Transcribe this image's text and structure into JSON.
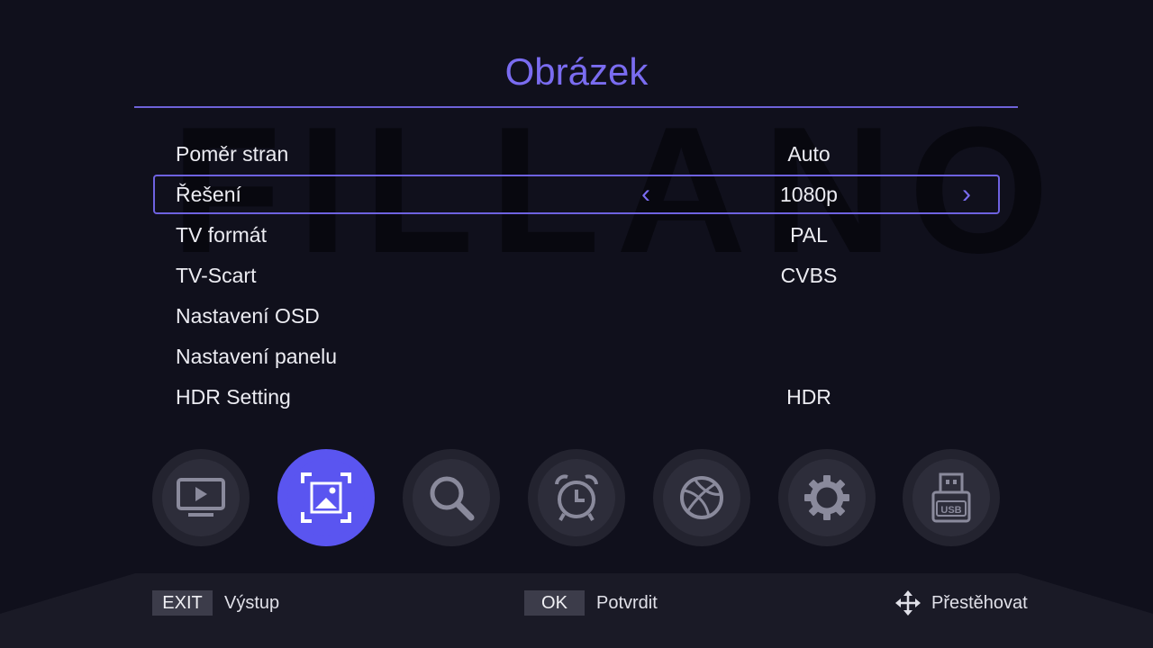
{
  "brand_watermark": "FILLANO",
  "title": "Obrázek",
  "menu": [
    {
      "label": "Poměr stran",
      "value": "Auto"
    },
    {
      "label": "Řešení",
      "value": "1080p"
    },
    {
      "label": "TV formát",
      "value": "PAL"
    },
    {
      "label": "TV-Scart",
      "value": "CVBS"
    },
    {
      "label": "Nastavení OSD",
      "value": ""
    },
    {
      "label": "Nastavení panelu",
      "value": ""
    },
    {
      "label": "HDR Setting",
      "value": "HDR"
    }
  ],
  "selected_index": 1,
  "selector": {
    "left": "‹",
    "right": "›"
  },
  "nav_icons": [
    {
      "name": "tv-icon",
      "active": false
    },
    {
      "name": "picture-icon",
      "active": true
    },
    {
      "name": "search-icon",
      "active": false
    },
    {
      "name": "alarm-clock-icon",
      "active": false
    },
    {
      "name": "network-ball-icon",
      "active": false
    },
    {
      "name": "gear-icon",
      "active": false
    },
    {
      "name": "usb-icon",
      "active": false,
      "text": "USB"
    }
  ],
  "footer": {
    "exit_key": "EXIT",
    "exit_label": "Výstup",
    "ok_key": "OK",
    "ok_label": "Potvrdit",
    "move_label": "Přestěhovat"
  },
  "colors": {
    "accent": "#7a6cf0",
    "active_icon": "#5a55f0",
    "background": "#10101c"
  }
}
